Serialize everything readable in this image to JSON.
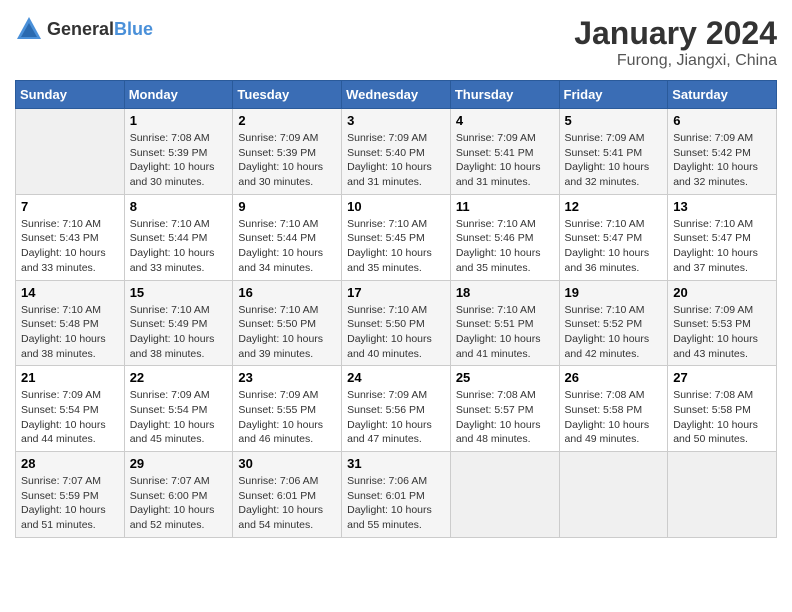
{
  "header": {
    "logo_general": "General",
    "logo_blue": "Blue",
    "title": "January 2024",
    "subtitle": "Furong, Jiangxi, China"
  },
  "weekdays": [
    "Sunday",
    "Monday",
    "Tuesday",
    "Wednesday",
    "Thursday",
    "Friday",
    "Saturday"
  ],
  "weeks": [
    [
      {
        "day": "",
        "sunrise": "",
        "sunset": "",
        "daylight": ""
      },
      {
        "day": "1",
        "sunrise": "Sunrise: 7:08 AM",
        "sunset": "Sunset: 5:39 PM",
        "daylight": "Daylight: 10 hours and 30 minutes."
      },
      {
        "day": "2",
        "sunrise": "Sunrise: 7:09 AM",
        "sunset": "Sunset: 5:39 PM",
        "daylight": "Daylight: 10 hours and 30 minutes."
      },
      {
        "day": "3",
        "sunrise": "Sunrise: 7:09 AM",
        "sunset": "Sunset: 5:40 PM",
        "daylight": "Daylight: 10 hours and 31 minutes."
      },
      {
        "day": "4",
        "sunrise": "Sunrise: 7:09 AM",
        "sunset": "Sunset: 5:41 PM",
        "daylight": "Daylight: 10 hours and 31 minutes."
      },
      {
        "day": "5",
        "sunrise": "Sunrise: 7:09 AM",
        "sunset": "Sunset: 5:41 PM",
        "daylight": "Daylight: 10 hours and 32 minutes."
      },
      {
        "day": "6",
        "sunrise": "Sunrise: 7:09 AM",
        "sunset": "Sunset: 5:42 PM",
        "daylight": "Daylight: 10 hours and 32 minutes."
      }
    ],
    [
      {
        "day": "7",
        "sunrise": "Sunrise: 7:10 AM",
        "sunset": "Sunset: 5:43 PM",
        "daylight": "Daylight: 10 hours and 33 minutes."
      },
      {
        "day": "8",
        "sunrise": "Sunrise: 7:10 AM",
        "sunset": "Sunset: 5:44 PM",
        "daylight": "Daylight: 10 hours and 33 minutes."
      },
      {
        "day": "9",
        "sunrise": "Sunrise: 7:10 AM",
        "sunset": "Sunset: 5:44 PM",
        "daylight": "Daylight: 10 hours and 34 minutes."
      },
      {
        "day": "10",
        "sunrise": "Sunrise: 7:10 AM",
        "sunset": "Sunset: 5:45 PM",
        "daylight": "Daylight: 10 hours and 35 minutes."
      },
      {
        "day": "11",
        "sunrise": "Sunrise: 7:10 AM",
        "sunset": "Sunset: 5:46 PM",
        "daylight": "Daylight: 10 hours and 35 minutes."
      },
      {
        "day": "12",
        "sunrise": "Sunrise: 7:10 AM",
        "sunset": "Sunset: 5:47 PM",
        "daylight": "Daylight: 10 hours and 36 minutes."
      },
      {
        "day": "13",
        "sunrise": "Sunrise: 7:10 AM",
        "sunset": "Sunset: 5:47 PM",
        "daylight": "Daylight: 10 hours and 37 minutes."
      }
    ],
    [
      {
        "day": "14",
        "sunrise": "Sunrise: 7:10 AM",
        "sunset": "Sunset: 5:48 PM",
        "daylight": "Daylight: 10 hours and 38 minutes."
      },
      {
        "day": "15",
        "sunrise": "Sunrise: 7:10 AM",
        "sunset": "Sunset: 5:49 PM",
        "daylight": "Daylight: 10 hours and 38 minutes."
      },
      {
        "day": "16",
        "sunrise": "Sunrise: 7:10 AM",
        "sunset": "Sunset: 5:50 PM",
        "daylight": "Daylight: 10 hours and 39 minutes."
      },
      {
        "day": "17",
        "sunrise": "Sunrise: 7:10 AM",
        "sunset": "Sunset: 5:50 PM",
        "daylight": "Daylight: 10 hours and 40 minutes."
      },
      {
        "day": "18",
        "sunrise": "Sunrise: 7:10 AM",
        "sunset": "Sunset: 5:51 PM",
        "daylight": "Daylight: 10 hours and 41 minutes."
      },
      {
        "day": "19",
        "sunrise": "Sunrise: 7:10 AM",
        "sunset": "Sunset: 5:52 PM",
        "daylight": "Daylight: 10 hours and 42 minutes."
      },
      {
        "day": "20",
        "sunrise": "Sunrise: 7:09 AM",
        "sunset": "Sunset: 5:53 PM",
        "daylight": "Daylight: 10 hours and 43 minutes."
      }
    ],
    [
      {
        "day": "21",
        "sunrise": "Sunrise: 7:09 AM",
        "sunset": "Sunset: 5:54 PM",
        "daylight": "Daylight: 10 hours and 44 minutes."
      },
      {
        "day": "22",
        "sunrise": "Sunrise: 7:09 AM",
        "sunset": "Sunset: 5:54 PM",
        "daylight": "Daylight: 10 hours and 45 minutes."
      },
      {
        "day": "23",
        "sunrise": "Sunrise: 7:09 AM",
        "sunset": "Sunset: 5:55 PM",
        "daylight": "Daylight: 10 hours and 46 minutes."
      },
      {
        "day": "24",
        "sunrise": "Sunrise: 7:09 AM",
        "sunset": "Sunset: 5:56 PM",
        "daylight": "Daylight: 10 hours and 47 minutes."
      },
      {
        "day": "25",
        "sunrise": "Sunrise: 7:08 AM",
        "sunset": "Sunset: 5:57 PM",
        "daylight": "Daylight: 10 hours and 48 minutes."
      },
      {
        "day": "26",
        "sunrise": "Sunrise: 7:08 AM",
        "sunset": "Sunset: 5:58 PM",
        "daylight": "Daylight: 10 hours and 49 minutes."
      },
      {
        "day": "27",
        "sunrise": "Sunrise: 7:08 AM",
        "sunset": "Sunset: 5:58 PM",
        "daylight": "Daylight: 10 hours and 50 minutes."
      }
    ],
    [
      {
        "day": "28",
        "sunrise": "Sunrise: 7:07 AM",
        "sunset": "Sunset: 5:59 PM",
        "daylight": "Daylight: 10 hours and 51 minutes."
      },
      {
        "day": "29",
        "sunrise": "Sunrise: 7:07 AM",
        "sunset": "Sunset: 6:00 PM",
        "daylight": "Daylight: 10 hours and 52 minutes."
      },
      {
        "day": "30",
        "sunrise": "Sunrise: 7:06 AM",
        "sunset": "Sunset: 6:01 PM",
        "daylight": "Daylight: 10 hours and 54 minutes."
      },
      {
        "day": "31",
        "sunrise": "Sunrise: 7:06 AM",
        "sunset": "Sunset: 6:01 PM",
        "daylight": "Daylight: 10 hours and 55 minutes."
      },
      {
        "day": "",
        "sunrise": "",
        "sunset": "",
        "daylight": ""
      },
      {
        "day": "",
        "sunrise": "",
        "sunset": "",
        "daylight": ""
      },
      {
        "day": "",
        "sunrise": "",
        "sunset": "",
        "daylight": ""
      }
    ]
  ]
}
